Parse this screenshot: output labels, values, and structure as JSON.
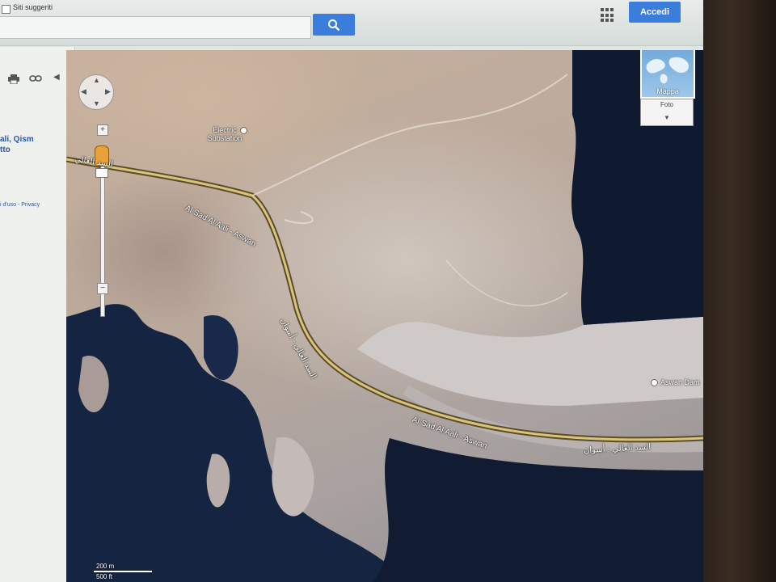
{
  "topbar": {
    "suggest_label": "Siti suggeriti",
    "login_label": "Accedi"
  },
  "left_panel": {
    "place_line1": "ali, Qism",
    "place_line2": "tto",
    "terms": "i d'uso - Privacy"
  },
  "map": {
    "labels": {
      "substation": "Electric Substation",
      "road_upper": "Al Sad Al Aali - Aswan",
      "road_lower": "Al Sad Al Aali - Aswan",
      "road_lower_arabic": "السد العالي - أسوان",
      "road_upper_arabic": "السد العالي",
      "road_vertical_arabic": "السد العالي - أسوان",
      "dam": "Aswan Dam"
    },
    "maptype_label": "Mappa",
    "photo_label": "Foto",
    "scale": {
      "metric": "200 m",
      "imperial": "500 ft"
    }
  },
  "colors": {
    "accent": "#3b7ddd",
    "water": "#14203a",
    "road": "#d9c47a"
  },
  "icons": {
    "search": "search-icon",
    "apps": "apps-grid-icon",
    "print": "print-icon",
    "link": "link-icon",
    "collapse": "chevron-left-icon",
    "pan": "pan-control-icon",
    "pegman": "pegman-icon"
  }
}
